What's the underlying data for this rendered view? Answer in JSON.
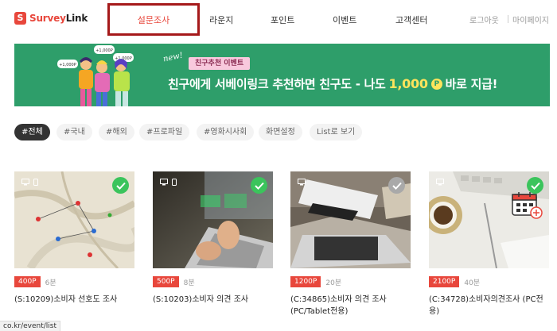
{
  "header": {
    "logo_text_part1": "Survey",
    "logo_text_part2": "Link",
    "nav": [
      "설문조사",
      "라운지",
      "포인트",
      "이벤트",
      "고객센터"
    ],
    "logout": "로그아웃",
    "mypage": "마이페이지"
  },
  "banner": {
    "new_label": "new!",
    "tag": "친구추천 이벤트",
    "headline_before": "친구에게 서베이링크 추천하면 친구도 - 나도",
    "amount": "1,000",
    "coin": "P",
    "headline_after": "바로 지급!",
    "bubbles": [
      "+1,000P",
      "+1,000P",
      "+1,000P"
    ]
  },
  "filters": [
    "#전체",
    "#국내",
    "#해외",
    "#프로파일",
    "#영화시사회",
    "화면설정",
    "List로 보기"
  ],
  "cards": [
    {
      "points": "400P",
      "minutes": "6분",
      "title": "(S:10209)소비자 선호도 조사",
      "check": "green"
    },
    {
      "points": "500P",
      "minutes": "8분",
      "title": "(S:10203)소비자 의견 조사",
      "check": "green"
    },
    {
      "points": "1200P",
      "minutes": "20분",
      "title": "(C:34865)소비자 의견 조사 (PC/Tablet전용)",
      "check": "gray"
    },
    {
      "points": "2100P",
      "minutes": "40분",
      "title": "(C:34728)소비자의견조사 (PC전용)",
      "check": "green"
    }
  ],
  "status_url": "co.kr/event/list",
  "colors": {
    "brand": "#e8473c",
    "banner_green": "#2e9e6a",
    "highlight_border": "#a5191a",
    "check_green": "#3bc45c"
  }
}
